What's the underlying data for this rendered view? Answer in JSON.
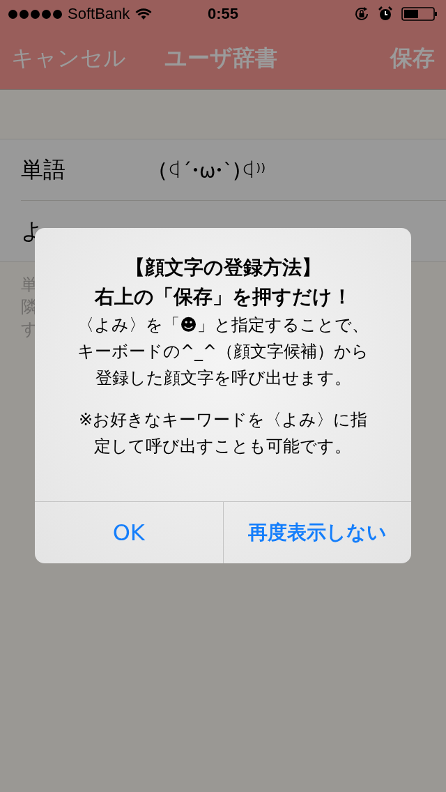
{
  "status_bar": {
    "carrier": "SoftBank",
    "time": "0:55"
  },
  "nav": {
    "left": "キャンセル",
    "title": "ユーザ辞書",
    "right": "保存"
  },
  "form": {
    "rows": [
      {
        "label": "単語",
        "value": "(ꒉ´･ω･`)ꒉ⁾⁾"
      },
      {
        "label": "よ"
      }
    ],
    "hint_lines": [
      "単",
      "隣",
      "す"
    ]
  },
  "alert": {
    "title_lines": [
      "【顔文字の登録方法】",
      "右上の「保存」を押すだけ！"
    ],
    "paragraphs": [
      [
        "〈よみ〉を「☻」と指定することで、",
        "キーボードの^_^（顔文字候補）から",
        "登録した顔文字を呼び出せます。"
      ],
      [
        "※お好きなキーワードを〈よみ〉に指",
        "定して呼び出すことも可能です。"
      ]
    ],
    "buttons": [
      {
        "label": "OK",
        "bold": false
      },
      {
        "label": "再度表示しない",
        "bold": true
      }
    ]
  }
}
